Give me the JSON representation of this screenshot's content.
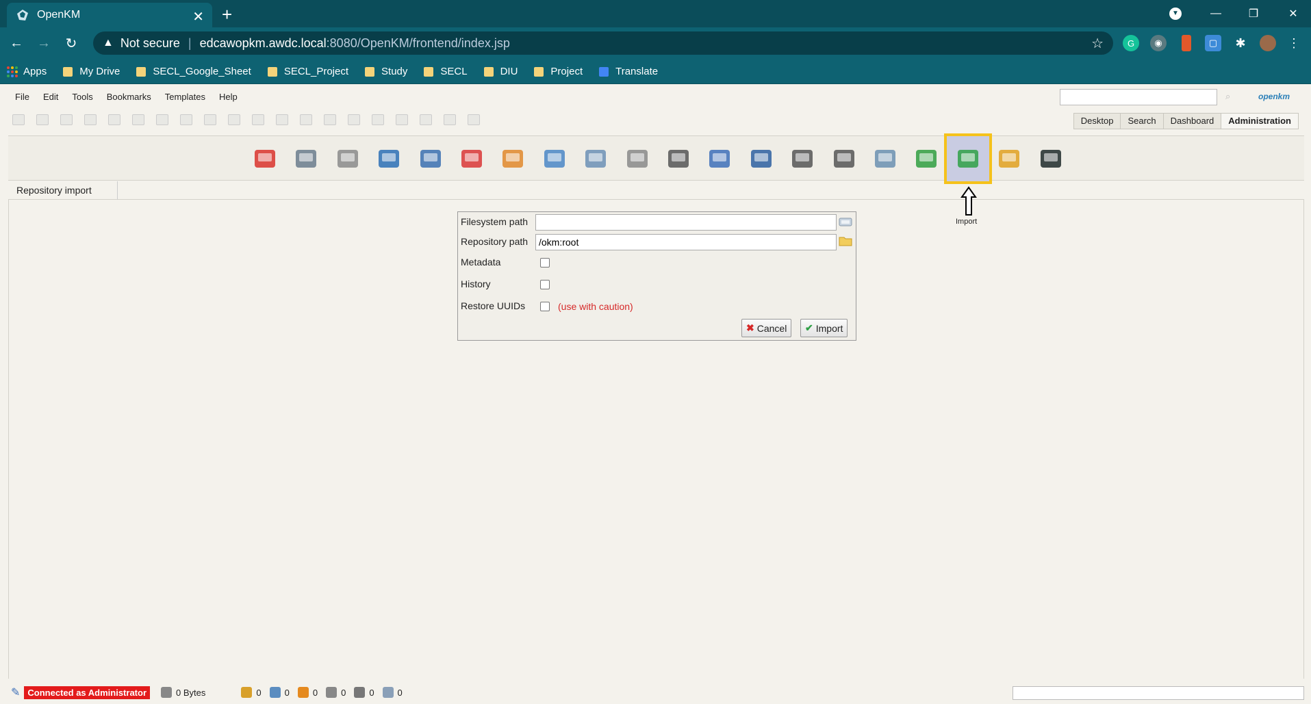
{
  "browser": {
    "tab_title": "OpenKM",
    "tab_close": "✕",
    "new_tab": "+",
    "security_label": "Not secure",
    "url_host": "edcawopkm.awdc.local",
    "url_path": ":8080/OpenKM/frontend/index.jsp",
    "window_controls": [
      "—",
      "❐",
      "✕"
    ]
  },
  "bookmarks": [
    {
      "label": "Apps",
      "icon": "apps-grid-icon"
    },
    {
      "label": "My Drive",
      "icon": "folder-icon"
    },
    {
      "label": "SECL_Google_Sheet",
      "icon": "folder-icon"
    },
    {
      "label": "SECL_Project",
      "icon": "folder-icon"
    },
    {
      "label": "Study",
      "icon": "folder-icon"
    },
    {
      "label": "SECL",
      "icon": "folder-icon"
    },
    {
      "label": "DIU",
      "icon": "folder-icon"
    },
    {
      "label": "Project",
      "icon": "folder-icon"
    },
    {
      "label": "Translate",
      "icon": "translate-icon"
    }
  ],
  "menu": [
    "File",
    "Edit",
    "Tools",
    "Bookmarks",
    "Templates",
    "Help"
  ],
  "brand": "openkm",
  "views": [
    "Desktop",
    "Search",
    "Dashboard",
    "Administration"
  ],
  "active_view": "Administration",
  "admin_tools": [
    {
      "name": "home-icon",
      "color": "#d9322b"
    },
    {
      "name": "configuration-tools-icon",
      "color": "#6a7b8c"
    },
    {
      "name": "search-tool-icon",
      "color": "#8a8a8a"
    },
    {
      "name": "monitor-stats-icon",
      "color": "#2b6fb5"
    },
    {
      "name": "workflow-icon",
      "color": "#3a6fb0"
    },
    {
      "name": "scissors-tool-icon",
      "color": "#d93636"
    },
    {
      "name": "users-icon",
      "color": "#e0872a"
    },
    {
      "name": "property-groups-icon",
      "color": "#4a86c5"
    },
    {
      "name": "report-icon",
      "color": "#6b8fb5"
    },
    {
      "name": "scanner-icon",
      "color": "#888888"
    },
    {
      "name": "calendar-icon",
      "color": "#555555"
    },
    {
      "name": "settings-gear-icon",
      "color": "#3d6fb8"
    },
    {
      "name": "database-query-icon",
      "color": "#2d5fa0"
    },
    {
      "name": "scheduler-clock-icon",
      "color": "#555555"
    },
    {
      "name": "mime-types-icon",
      "color": "#555555"
    },
    {
      "name": "language-tool-icon",
      "color": "#6a8fb0"
    },
    {
      "name": "stamps-icon",
      "color": "#2f9e3f"
    },
    {
      "name": "import-icon",
      "color": "#2fa046"
    },
    {
      "name": "export-icon",
      "color": "#e0a020"
    },
    {
      "name": "terminal-icon",
      "color": "#1e2a2a"
    }
  ],
  "breadcrumb": "Repository import",
  "annotation_label": "Import",
  "form": {
    "filesystem_label": "Filesystem path",
    "filesystem_value": "",
    "repository_label": "Repository path",
    "repository_value": "/okm:root",
    "metadata_label": "Metadata",
    "history_label": "History",
    "restore_label": "Restore UUIDs",
    "caution": "(use with caution)",
    "cancel": "Cancel",
    "import": "Import"
  },
  "status": {
    "connected": "Connected as Administrator",
    "size": "0 Bytes",
    "counters": [
      {
        "icon": "locked-docs-icon",
        "value": "0",
        "color": "#d8a02a"
      },
      {
        "icon": "checkout-docs-icon",
        "value": "0",
        "color": "#5b8dc0"
      },
      {
        "icon": "messages-icon",
        "value": "0",
        "color": "#e58a1f"
      },
      {
        "icon": "subscriptions-icon",
        "value": "0",
        "color": "#888888"
      },
      {
        "icon": "workflow-tasks-icon",
        "value": "0",
        "color": "#777777"
      },
      {
        "icon": "pooled-tasks-icon",
        "value": "0",
        "color": "#8aa0b8"
      }
    ]
  }
}
